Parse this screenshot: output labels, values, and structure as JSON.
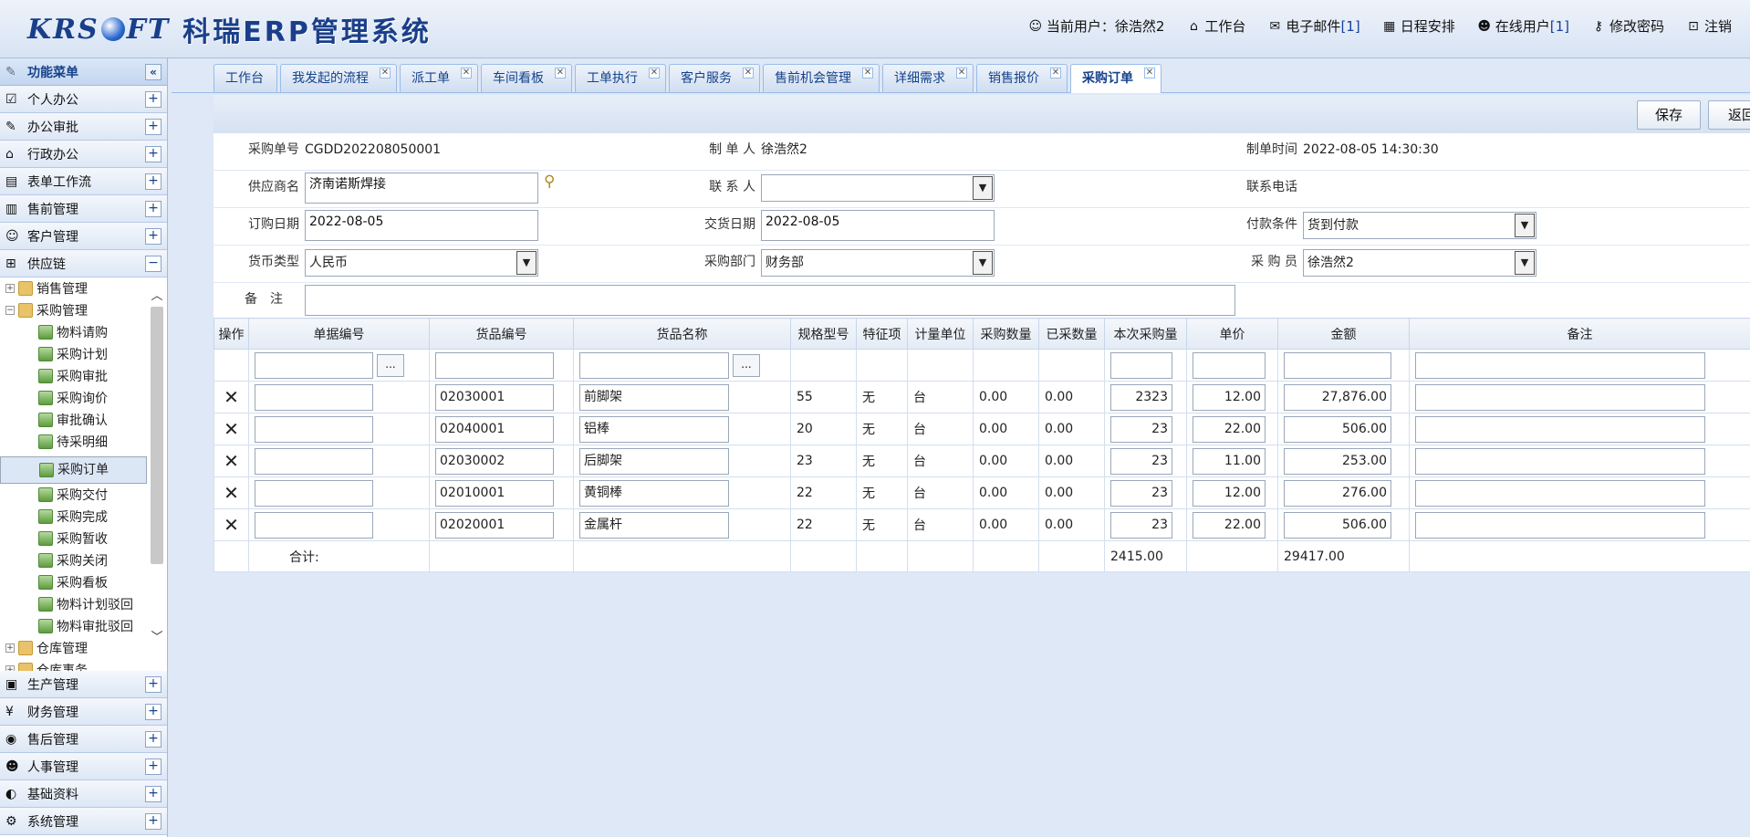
{
  "header": {
    "brand": "KRSOFT",
    "system_title": "科瑞ERP管理系统",
    "links": [
      {
        "icon": "user-icon",
        "label": "当前用户：",
        "value": "徐浩然2"
      },
      {
        "icon": "home-icon",
        "label": "工作台"
      },
      {
        "icon": "mail-icon",
        "label": "电子邮件 ",
        "count": "[1]"
      },
      {
        "icon": "calendar-icon",
        "label": "日程安排"
      },
      {
        "icon": "users-icon",
        "label": "在线用户 ",
        "count": "[1]"
      },
      {
        "icon": "key-icon",
        "label": "修改密码"
      },
      {
        "icon": "lock-icon",
        "label": "注销"
      }
    ]
  },
  "sidebar": {
    "title": "功能菜单",
    "collapse_glyph": "«",
    "sections_top": [
      {
        "label": "个人办公",
        "icon": "personal-office-icon",
        "pm": "+"
      },
      {
        "label": "办公审批",
        "icon": "approval-icon",
        "pm": "+"
      },
      {
        "label": "行政办公",
        "icon": "admin-office-icon",
        "pm": "+"
      },
      {
        "label": "表单工作流",
        "icon": "workflow-icon",
        "pm": "+"
      },
      {
        "label": "售前管理",
        "icon": "presales-icon",
        "pm": "+"
      },
      {
        "label": "客户管理",
        "icon": "customer-icon",
        "pm": "+"
      },
      {
        "label": "供应链",
        "icon": "supply-chain-icon",
        "pm": "−"
      }
    ],
    "tree": [
      {
        "level": 1,
        "toggle": "+",
        "label": "销售管理"
      },
      {
        "level": 1,
        "toggle": "−",
        "label": "采购管理"
      },
      {
        "level": 2,
        "label": "物料请购"
      },
      {
        "level": 2,
        "label": "采购计划"
      },
      {
        "level": 2,
        "label": "采购审批"
      },
      {
        "level": 2,
        "label": "采购询价"
      },
      {
        "level": 2,
        "label": "审批确认"
      },
      {
        "level": 2,
        "label": "待采明细"
      },
      {
        "level": 2,
        "label": "采购订单",
        "selected": true
      },
      {
        "level": 2,
        "label": "采购交付"
      },
      {
        "level": 2,
        "label": "采购完成"
      },
      {
        "level": 2,
        "label": "采购暂收"
      },
      {
        "level": 2,
        "label": "采购关闭"
      },
      {
        "level": 2,
        "label": "采购看板"
      },
      {
        "level": 2,
        "label": "物料计划驳回"
      },
      {
        "level": 2,
        "label": "物料审批驳回"
      },
      {
        "level": 1,
        "toggle": "+",
        "label": "仓库管理"
      },
      {
        "level": 1,
        "toggle": "+",
        "label": "仓库事务"
      }
    ],
    "sections_bottom": [
      {
        "label": "生产管理",
        "icon": "production-icon",
        "pm": "+"
      },
      {
        "label": "财务管理",
        "icon": "finance-icon",
        "pm": "+"
      },
      {
        "label": "售后管理",
        "icon": "aftersales-icon",
        "pm": "+"
      },
      {
        "label": "人事管理",
        "icon": "hr-icon",
        "pm": "+"
      },
      {
        "label": "基础资料",
        "icon": "basic-data-icon",
        "pm": "+"
      },
      {
        "label": "系统管理",
        "icon": "system-icon",
        "pm": "+"
      }
    ]
  },
  "tabs": [
    {
      "label": "工作台",
      "closable": false
    },
    {
      "label": "我发起的流程",
      "closable": true
    },
    {
      "label": "派工单",
      "closable": true
    },
    {
      "label": "车间看板",
      "closable": true
    },
    {
      "label": "工单执行",
      "closable": true
    },
    {
      "label": "客户服务",
      "closable": true
    },
    {
      "label": "售前机会管理",
      "closable": true
    },
    {
      "label": "详细需求",
      "closable": true
    },
    {
      "label": "销售报价",
      "closable": true
    },
    {
      "label": "采购订单",
      "closable": true,
      "active": true
    }
  ],
  "toolbar": {
    "save": "保存",
    "back": "返回"
  },
  "form": {
    "order_no_label": "采购单号",
    "order_no": "CGDD202208050001",
    "maker_label": "制 单 人",
    "maker": "徐浩然2",
    "make_time_label": "制单时间",
    "make_time": "2022-08-05 14:30:30",
    "supplier_label": "供应商名",
    "supplier": "济南诺斯焊接",
    "contact_label": "联 系 人",
    "contact": "",
    "phone_label": "联系电话",
    "order_date_label": "订购日期",
    "order_date": "2022-08-05",
    "delivery_date_label": "交货日期",
    "delivery_date": "2022-08-05",
    "payment_label": "付款条件",
    "payment": "货到付款",
    "currency_label": "货币类型",
    "currency": "人民币",
    "dept_label": "采购部门",
    "dept": "财务部",
    "buyer_label": "采 购 员",
    "buyer": "徐浩然2",
    "remark_label": "备　注",
    "remark": ""
  },
  "grid": {
    "columns": [
      "操作",
      "单据编号",
      "货品编号",
      "货品名称",
      "规格型号",
      "特征项",
      "计量单位",
      "采购数量",
      "已采数量",
      "本次采购量",
      "单价",
      "金额",
      "备注"
    ],
    "rows": [
      {
        "doc": "",
        "code": "02030001",
        "name": "前脚架",
        "spec": "55",
        "feat": "无",
        "unit": "台",
        "qty": "0.00",
        "done": "0.00",
        "cur": "2323",
        "price": "12.00",
        "amount": "27,876.00",
        "note": ""
      },
      {
        "doc": "",
        "code": "02040001",
        "name": "铝棒",
        "spec": "20",
        "feat": "无",
        "unit": "台",
        "qty": "0.00",
        "done": "0.00",
        "cur": "23",
        "price": "22.00",
        "amount": "506.00",
        "note": ""
      },
      {
        "doc": "",
        "code": "02030002",
        "name": "后脚架",
        "spec": "23",
        "feat": "无",
        "unit": "台",
        "qty": "0.00",
        "done": "0.00",
        "cur": "23",
        "price": "11.00",
        "amount": "253.00",
        "note": ""
      },
      {
        "doc": "",
        "code": "02010001",
        "name": "黄铜棒",
        "spec": "22",
        "feat": "无",
        "unit": "台",
        "qty": "0.00",
        "done": "0.00",
        "cur": "23",
        "price": "12.00",
        "amount": "276.00",
        "note": ""
      },
      {
        "doc": "",
        "code": "02020001",
        "name": "金属杆",
        "spec": "22",
        "feat": "无",
        "unit": "台",
        "qty": "0.00",
        "done": "0.00",
        "cur": "23",
        "price": "22.00",
        "amount": "506.00",
        "note": ""
      }
    ],
    "more_glyph": "...",
    "delete_glyph": "✕",
    "sum_label": "合计:",
    "sum_cur": "2415.00",
    "sum_amount": "29417.00"
  }
}
